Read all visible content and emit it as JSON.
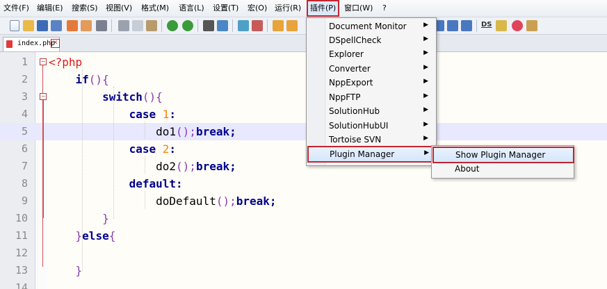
{
  "menubar": {
    "items": [
      "文件(F)",
      "编辑(E)",
      "搜索(S)",
      "视图(V)",
      "格式(M)",
      "语言(L)",
      "设置(T)",
      "宏(O)",
      "运行(R)",
      "插件(P)",
      "窗口(W)",
      "?"
    ],
    "active_index": 9
  },
  "toolbar": {
    "ds_label": "DS"
  },
  "tab": {
    "filename": "index.php",
    "close_glyph": "✕"
  },
  "editor": {
    "current_line": 5,
    "lines": [
      {
        "n": "1"
      },
      {
        "n": "2"
      },
      {
        "n": "3"
      },
      {
        "n": "4"
      },
      {
        "n": "5"
      },
      {
        "n": "6"
      },
      {
        "n": "7"
      },
      {
        "n": "8"
      },
      {
        "n": "9"
      },
      {
        "n": "10"
      },
      {
        "n": "11"
      },
      {
        "n": "12"
      },
      {
        "n": "13"
      },
      {
        "n": "14"
      }
    ],
    "code": {
      "l1": "<?php",
      "l2_kw": "if",
      "l2_p": "(){",
      "l3_kw": "switch",
      "l3_p": "(){",
      "l4_kw": "case",
      "l4_num": "1",
      "l4_c": ":",
      "l5_fn": "do1",
      "l5_p": "();",
      "l5_kw": "break",
      "l5_s": ";",
      "l6_kw": "case",
      "l6_num": "2",
      "l6_c": ":",
      "l7_fn": "do2",
      "l7_p": "();",
      "l7_kw": "break",
      "l7_s": ";",
      "l8_kw": "default",
      "l8_c": ":",
      "l9_fn": "doDefault",
      "l9_p": "();",
      "l9_kw": "break",
      "l9_s": ";",
      "l10": "}",
      "l11_p": "}",
      "l11_kw": "else",
      "l11_p2": "{",
      "l13": "}"
    }
  },
  "plugins_menu": {
    "items": [
      {
        "label": "Document Monitor",
        "arrow": "▶"
      },
      {
        "label": "DSpellCheck",
        "arrow": "▶"
      },
      {
        "label": "Explorer",
        "arrow": "▶"
      },
      {
        "label": "Converter",
        "arrow": "▶"
      },
      {
        "label": "NppExport",
        "arrow": "▶"
      },
      {
        "label": "NppFTP",
        "arrow": "▶"
      },
      {
        "label": "SolutionHub",
        "arrow": "▶"
      },
      {
        "label": "SolutionHubUI",
        "arrow": "▶"
      },
      {
        "label": "Tortoise SVN",
        "arrow": "▶"
      },
      {
        "label": "Plugin Manager",
        "arrow": "▶"
      }
    ],
    "highlighted_index": 9
  },
  "plugin_manager_submenu": {
    "items": [
      "Show Plugin Manager",
      "About"
    ],
    "highlighted_index": 0
  },
  "colors": {
    "highlight_outline": "#c0262e",
    "keyword": "#00008b",
    "php_tag": "#e21919",
    "number": "#ff8000",
    "punct": "#8b3bb4"
  }
}
